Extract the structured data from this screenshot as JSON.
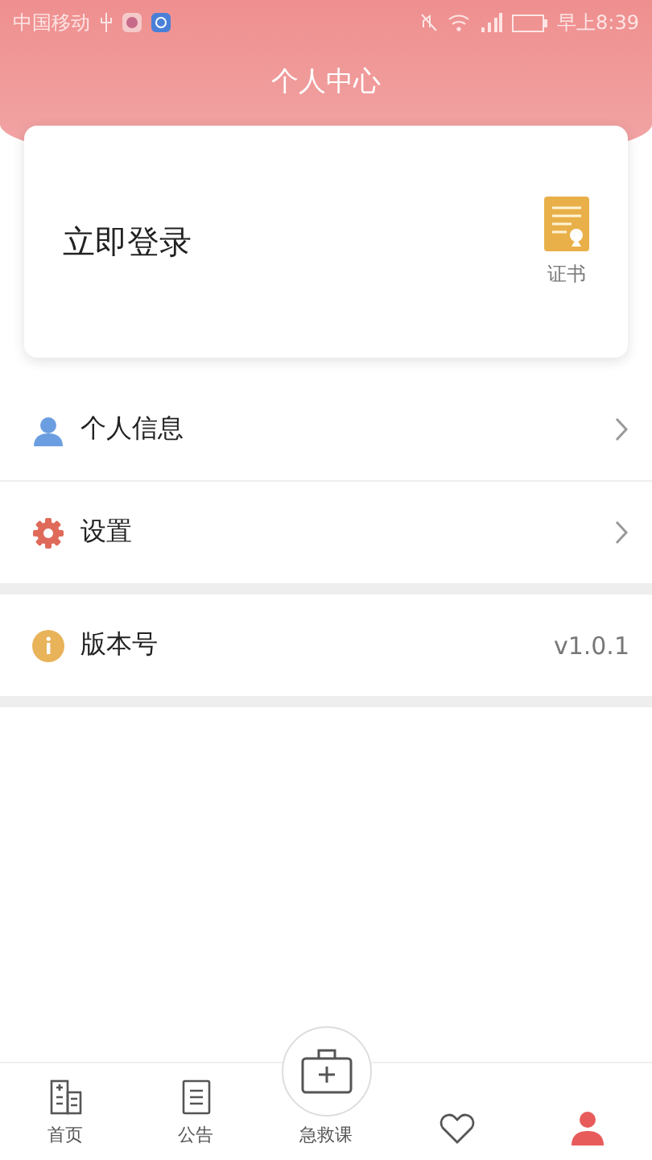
{
  "status_bar": {
    "carrier": "中国移动",
    "time": "早上8:39"
  },
  "header": {
    "title": "个人中心"
  },
  "login_card": {
    "login_text": "立即登录",
    "certificate_label": "证书"
  },
  "menu_groups": [
    {
      "items": [
        {
          "kind": "person",
          "label": "个人信息",
          "chevron": true
        },
        {
          "kind": "gear",
          "label": "设置",
          "chevron": true
        }
      ]
    },
    {
      "items": [
        {
          "kind": "info",
          "label": "版本号",
          "value": "v1.0.1",
          "chevron": false
        }
      ]
    }
  ],
  "tab_bar": {
    "items": [
      {
        "kind": "building",
        "label": "首页",
        "selected": false
      },
      {
        "kind": "document",
        "label": "公告",
        "selected": false
      },
      {
        "kind": "firstaid",
        "label": "急救课",
        "selected": false
      },
      {
        "kind": "heart",
        "selected": false
      },
      {
        "kind": "person",
        "selected": true
      }
    ]
  }
}
